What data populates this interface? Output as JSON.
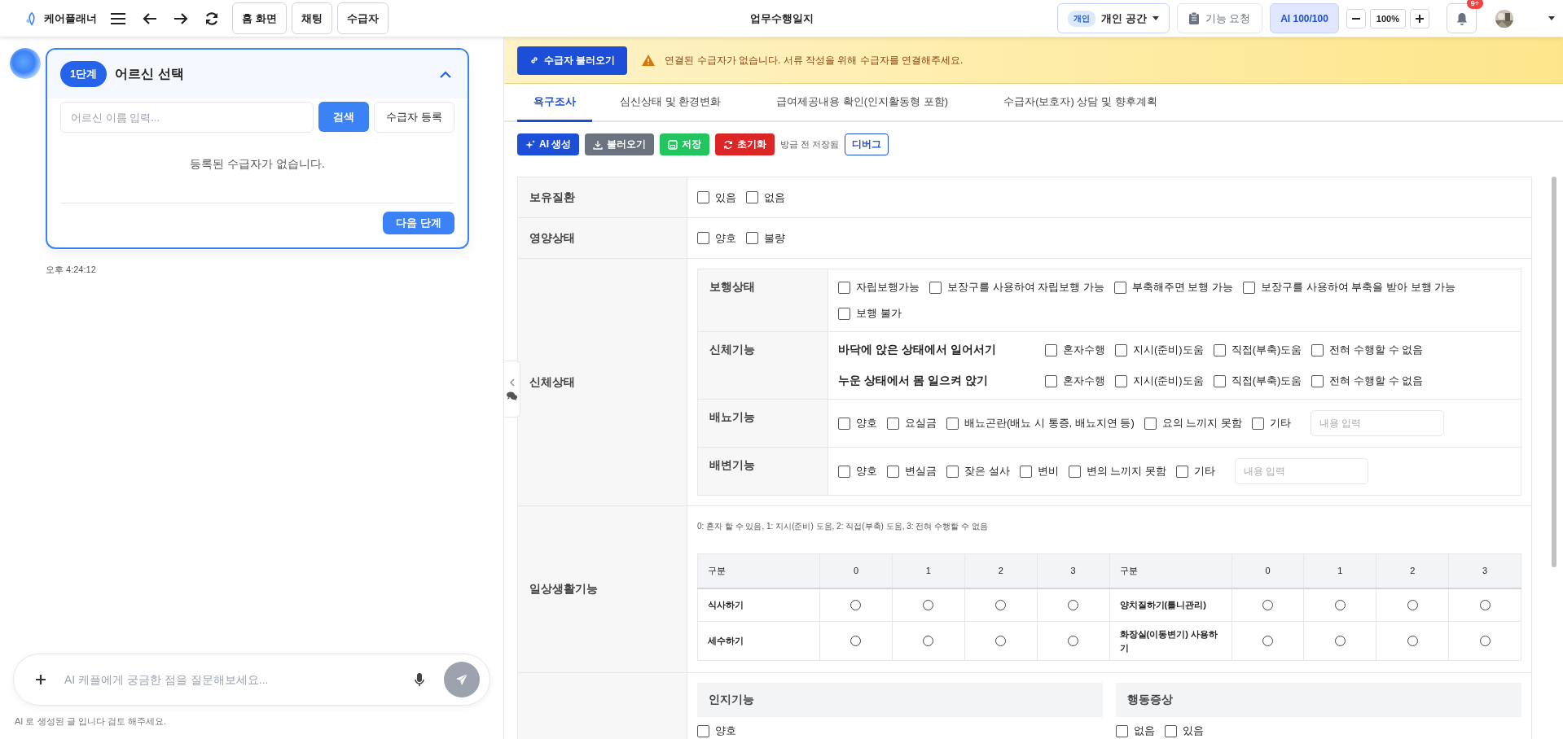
{
  "app": {
    "name": "케어플래너"
  },
  "nav_buttons": [
    "홈 화면",
    "채팅",
    "수급자"
  ],
  "page_title": "업무수행일지",
  "workspace": {
    "badge": "개인",
    "label": "개인 공간"
  },
  "feature_request": "기능 요청",
  "ai_quota": "AI 100/100",
  "zoom_value": "100%",
  "notification_badge": "9+",
  "step_card": {
    "step": "1단계",
    "title": "어르신 선택",
    "expanded": true,
    "search_placeholder": "어르신 이름 입력...",
    "search_button": "검색",
    "register_button": "수급자 등록",
    "empty_message": "등록된 수급자가 없습니다.",
    "next_button": "다음 단계"
  },
  "message_time": "오후 4:24:12",
  "chat": {
    "placeholder": "AI 케플에게 궁금한 점을 질문해보세요...",
    "disclaimer": "AI 로 생성된 글 입니다 검토 해주세요."
  },
  "banner": {
    "button": "수급자 불러오기",
    "message": "연결된 수급자가 없습니다. 서류 작성을 위해 수급자를 연결해주세요."
  },
  "tabs": [
    {
      "label": "욕구조사",
      "selected": true
    },
    {
      "label": "심신상태 및 환경변화",
      "selected": false
    },
    {
      "label": "급여제공내용 확인(인지활동형 포함)",
      "selected": false
    },
    {
      "label": "수급자(보호자) 상담 및 향후계획",
      "selected": false
    }
  ],
  "toolbar": {
    "buttons": [
      {
        "label": "AI 생성",
        "kind": "ai"
      },
      {
        "label": "불러오기",
        "kind": "load"
      },
      {
        "label": "저장",
        "kind": "save"
      },
      {
        "label": "초기화",
        "kind": "reset"
      }
    ],
    "save_status": "방금 전 저장됨",
    "debug_button": "디버그"
  },
  "sections": [
    {
      "kind": "checks",
      "label": "보유질환",
      "options": [
        {
          "label": "있음",
          "checked": false
        },
        {
          "label": "없음",
          "checked": false
        }
      ]
    },
    {
      "kind": "checks",
      "label": "영양상태",
      "options": [
        {
          "label": "양호",
          "checked": false
        },
        {
          "label": "불량",
          "checked": false
        }
      ]
    },
    {
      "kind": "nested",
      "label": "신체상태",
      "groups": [
        {
          "kind": "checks",
          "label": "보행상태",
          "options": [
            {
              "label": "자립보행가능",
              "checked": false
            },
            {
              "label": "보장구를 사용하여 자립보행 가능",
              "checked": false
            },
            {
              "label": "부축해주면 보행 가능",
              "checked": false
            },
            {
              "label": "보장구를 사용하여 부축을 받아 보행 가능",
              "checked": false
            },
            {
              "label": "보행 불가",
              "checked": false
            }
          ]
        },
        {
          "kind": "items",
          "label": "신체기능",
          "items": [
            {
              "label": "바닥에 앉은 상태에서 일어서기",
              "options": [
                {
                  "label": "혼자수행",
                  "checked": false
                },
                {
                  "label": "지시(준비)도움",
                  "checked": false
                },
                {
                  "label": "직접(부축)도움",
                  "checked": false
                },
                {
                  "label": "전혀 수행할 수 없음",
                  "checked": false
                }
              ]
            },
            {
              "label": "누운 상태에서 몸 일으켜 앉기",
              "options": [
                {
                  "label": "혼자수행",
                  "checked": false
                },
                {
                  "label": "지시(준비)도움",
                  "checked": false
                },
                {
                  "label": "직접(부축)도움",
                  "checked": false
                },
                {
                  "label": "전혀 수행할 수 없음",
                  "checked": false
                }
              ]
            }
          ]
        },
        {
          "kind": "checks",
          "label": "배뇨기능",
          "options": [
            {
              "label": "양호",
              "checked": false
            },
            {
              "label": "요실금",
              "checked": false
            },
            {
              "label": "배뇨곤란(배뇨 시 통증, 배뇨지연 등)",
              "checked": false
            },
            {
              "label": "요의 느끼지 못함",
              "checked": false
            },
            {
              "label": "기타",
              "checked": false
            }
          ],
          "input_placeholder": "내용 입력"
        },
        {
          "kind": "checks",
          "label": "배변기능",
          "options": [
            {
              "label": "양호",
              "checked": false
            },
            {
              "label": "변실금",
              "checked": false
            },
            {
              "label": "잦은 설사",
              "checked": false
            },
            {
              "label": "변비",
              "checked": false
            },
            {
              "label": "변의 느끼지 못함",
              "checked": false
            },
            {
              "label": "기타",
              "checked": false
            }
          ],
          "input_placeholder": "내용 입력"
        }
      ]
    },
    {
      "kind": "grid",
      "label": "일상생활기능",
      "note": "0: 혼자 할 수 있음, 1: 지시(준비) 도움, 2: 직접(부축) 도움, 3: 전혀 수행할 수 없음",
      "columns": [
        "구분",
        "0",
        "1",
        "2",
        "3",
        "구분",
        "0",
        "1",
        "2",
        "3"
      ],
      "rows": [
        {
          "items": [
            {
              "label": "식사하기",
              "options": [
                {
                  "selected": false
                },
                {
                  "selected": false
                },
                {
                  "selected": false
                },
                {
                  "selected": false
                }
              ]
            },
            {
              "label": "양치질하기(틀니관리)",
              "options": [
                {
                  "selected": false
                },
                {
                  "selected": false
                },
                {
                  "selected": false
                },
                {
                  "selected": false
                }
              ]
            }
          ]
        },
        {
          "items": [
            {
              "label": "세수하기",
              "options": [
                {
                  "selected": false
                },
                {
                  "selected": false
                },
                {
                  "selected": false
                },
                {
                  "selected": false
                }
              ]
            },
            {
              "label": "화장실(이동변기) 사용하기",
              "options": [
                {
                  "selected": false
                },
                {
                  "selected": false
                },
                {
                  "selected": false
                },
                {
                  "selected": false
                }
              ]
            }
          ]
        }
      ]
    },
    {
      "kind": "panels",
      "panels": [
        {
          "title": "인지기능",
          "options": [
            {
              "label": "양호",
              "checked": false
            }
          ]
        },
        {
          "title": "행동증상",
          "options": [
            {
              "label": "없음",
              "checked": false
            },
            {
              "label": "있음",
              "checked": false
            }
          ]
        }
      ]
    }
  ]
}
